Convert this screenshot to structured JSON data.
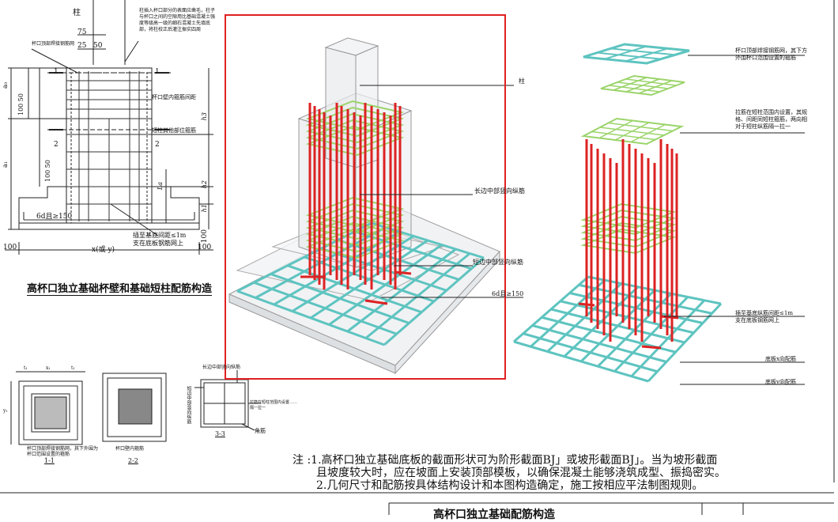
{
  "colors": {
    "highlight_frame": "#e02020",
    "rebar_red": "#dd2222",
    "rebar_cyan": "#5ec4c0",
    "rebar_green": "#9bd46a",
    "line": "#222222"
  },
  "left_drawing": {
    "labels": {
      "column": "柱",
      "column_note": "柱插入杯口部分的表面应凿毛，柱子与杯口之间的空隙用比基础混凝土强度等级高一级的细石混凝土先填底部，将柱校正后灌注振实四周",
      "cup_top_mesh": "杯口顶部焊接钢筋网",
      "dim_75": "75",
      "dim_25": "25",
      "dim_50": "50",
      "sec1_left": "1",
      "sec1_right": "1",
      "cup_wall_stirrup": "杯口壁内箍筋间距",
      "short_column_stirrup": "短柱其他部位箍筋",
      "sec2_left": "2",
      "sec2_right": "2",
      "dim_a0": "a₀",
      "dim_a1": "a₁",
      "dim_100_50": "100 50",
      "dim_100_50b": "100 50",
      "dim_h3": "h3",
      "dim_h2": "h2",
      "dim_h1": "h1",
      "dim_la": "La",
      "dim_6d": "6d且≥150",
      "anchor_note": "插至基底间距≤1m\n支在底板钢筋网上",
      "dim_100a": "100",
      "dim_xy": "x(或 y)",
      "dim_100b": "100",
      "dim_100c": "100"
    },
    "title": "高杯口独立基础杯壁和基础短柱配筋构造"
  },
  "center_3d": {
    "labels": {
      "column": "柱",
      "long_side_middle": "长边中部竖向纵筋",
      "short_side_middle": "短边中部竖向纵筋",
      "hook": "6d且≥150"
    }
  },
  "right_exploded": {
    "labels": {
      "top_mesh": "杯口顶部焊接钢筋网，其下方外围杯口范围设置的箍筋",
      "tie_note": "拉筋在短柱范围内设置，其规格、间距同短柱箍筋，两向相对于短柱纵筋隔一拉一",
      "anchor": "插至基底纵筋间距≤1m\n支在底板钢筋网上",
      "x_bar": "底板x向配筋",
      "y_bar": "底板y向配筋"
    }
  },
  "sections": {
    "s11": {
      "label": "1-1",
      "note": "杯口顶部焊接钢筋网，其下外围为杯口范围设置的箍筋",
      "dims": [
        "t₁",
        "x₁",
        "t₁",
        "y₁"
      ]
    },
    "s22": {
      "label": "2-2",
      "note": "杯口壁内箍筋"
    },
    "s33": {
      "label": "3-3",
      "top": "长边中部竖向纵筋",
      "left": "短边中部竖向纵筋",
      "right": "拉筋在短柱范围内设置……隔一拉一",
      "corner": "角筋"
    }
  },
  "notes": {
    "line1": "注 :1.高杯口独立基础底板的截面形状可为阶形截面BJ」或坡形截面BJ」。当为坡形截面",
    "line2": "且坡度较大时，应在坡面上安装顶部模板，以确保混凝土能够浇筑成型、振捣密实。",
    "line3": "2.几何尺寸和配筋按具体结构设计和本图构造确定，施工按相应平法制图规则。"
  },
  "title_block": {
    "text": "高杯口独立基础配筋构造"
  }
}
